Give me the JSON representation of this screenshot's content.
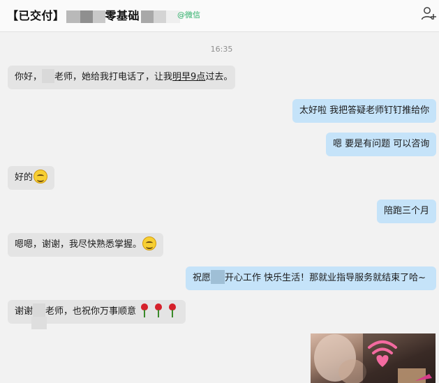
{
  "header": {
    "title_prefix": "【已交付】",
    "title_middle": "零基础",
    "wechat_tag": "@微信",
    "add_contact_icon": "add-contact-icon"
  },
  "chat": {
    "timestamp": "16:35",
    "messages": [
      {
        "side": "left",
        "parts": [
          "你好，",
          "老师，她给我打电话了，让我",
          "明早9点",
          "过去。"
        ]
      },
      {
        "side": "right",
        "text": "太好啦 我把答疑老师钉钉推给你"
      },
      {
        "side": "right",
        "text": "嗯 要是有问题 可以咨询"
      },
      {
        "side": "left",
        "text": "好的",
        "emoji": "smile-emoji"
      },
      {
        "side": "right",
        "text": "陪跑三个月"
      },
      {
        "side": "left",
        "text": "嗯嗯，谢谢，我尽快熟悉掌握。",
        "emoji": "smile-emoji"
      },
      {
        "side": "right",
        "parts": [
          "祝愿",
          "开心工作 快乐生活！那就业指导服务就结束了哈~"
        ]
      },
      {
        "side": "left",
        "parts": [
          "谢谢",
          "老师，也祝你万事顺意"
        ],
        "emoji": "rose-emoji"
      }
    ]
  },
  "video": {
    "icon": "live-stream-icon"
  },
  "colors": {
    "background": "#f2f2f2",
    "left_bubble": "#e4e4e4",
    "right_bubble": "#c5e3f9",
    "wechat_green": "#2aae67",
    "live_pink": "#f36aa0"
  }
}
